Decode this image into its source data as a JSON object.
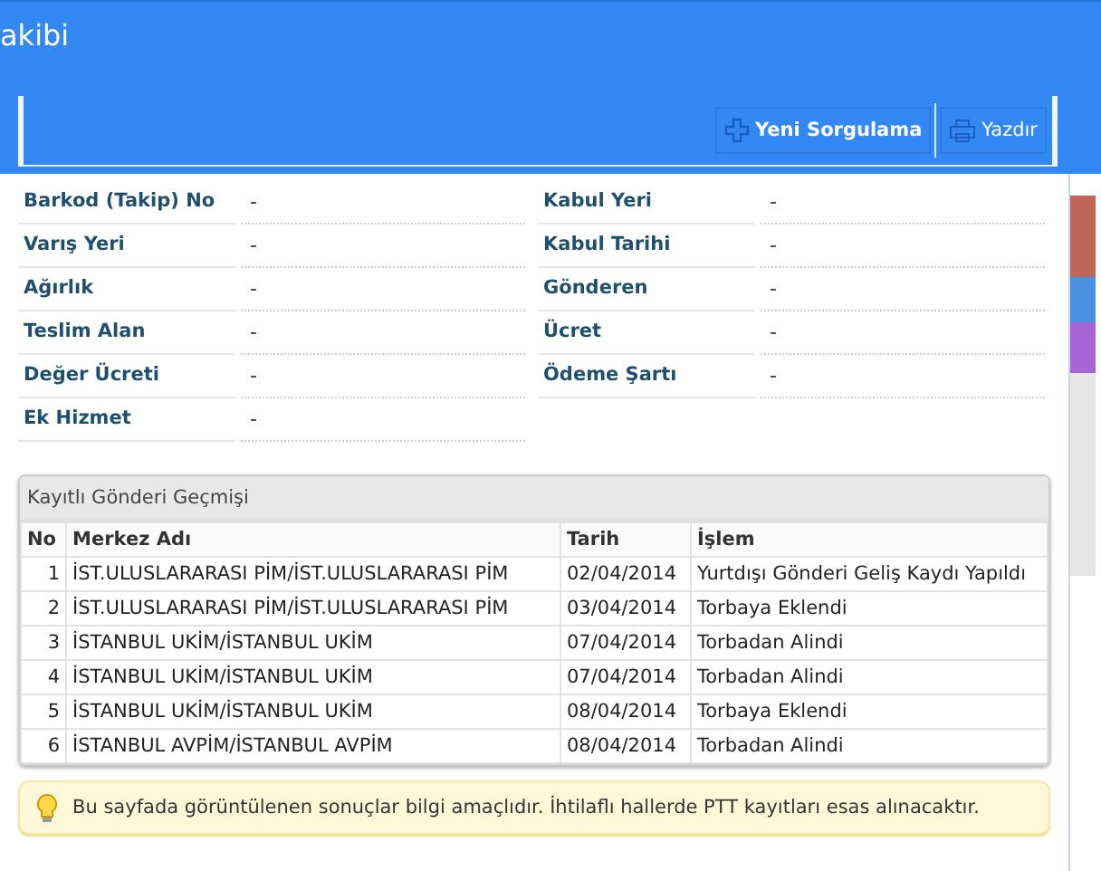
{
  "page": {
    "title": "akibi"
  },
  "toolbar": {
    "buttons": [
      {
        "label": "Yeni Sorgulama",
        "kind": "new"
      },
      {
        "label": "Yazdır",
        "kind": "print"
      }
    ]
  },
  "details": {
    "left": [
      {
        "label": "Barkod (Takip) No",
        "value": "-"
      },
      {
        "label": "Varış Yeri",
        "value": "-"
      },
      {
        "label": "Ağırlık",
        "value": "-"
      },
      {
        "label": "Teslim Alan",
        "value": "-"
      },
      {
        "label": "Değer Ücreti",
        "value": "-"
      },
      {
        "label": "Ek Hizmet",
        "value": "-"
      }
    ],
    "right": [
      {
        "label": "Kabul Yeri",
        "value": "-"
      },
      {
        "label": "Kabul Tarihi",
        "value": "-"
      },
      {
        "label": "Gönderen",
        "value": "-"
      },
      {
        "label": "Ücret",
        "value": "-"
      },
      {
        "label": "Ödeme Şartı",
        "value": "-"
      }
    ]
  },
  "history": {
    "title": "Kayıtlı Gönderi Geçmişi",
    "columns": [
      "No",
      "Merkez Adı",
      "Tarih",
      "İşlem"
    ],
    "rows": [
      [
        "1",
        "İST.ULUSLARARASI PİM/İST.ULUSLARARASI PİM",
        "02/04/2014",
        "Yurtdışı Gönderi Geliş Kaydı Yapıldı"
      ],
      [
        "2",
        "İST.ULUSLARARASI PİM/İST.ULUSLARARASI PİM",
        "03/04/2014",
        "Torbaya Eklendi"
      ],
      [
        "3",
        "İSTANBUL UKİM/İSTANBUL UKİM",
        "07/04/2014",
        "Torbadan Alindi"
      ],
      [
        "4",
        "İSTANBUL UKİM/İSTANBUL UKİM",
        "07/04/2014",
        "Torbadan Alindi"
      ],
      [
        "5",
        "İSTANBUL UKİM/İSTANBUL UKİM",
        "08/04/2014",
        "Torbaya Eklendi"
      ],
      [
        "6",
        "İSTANBUL AVPİM/İSTANBUL AVPİM",
        "08/04/2014",
        "Torbadan Alindi"
      ]
    ]
  },
  "notice": {
    "text": "Bu sayfada görüntülenen sonuçlar bilgi amaçlıdır. İhtilaflı hallerde PTT kayıtları esas alınacaktır."
  }
}
